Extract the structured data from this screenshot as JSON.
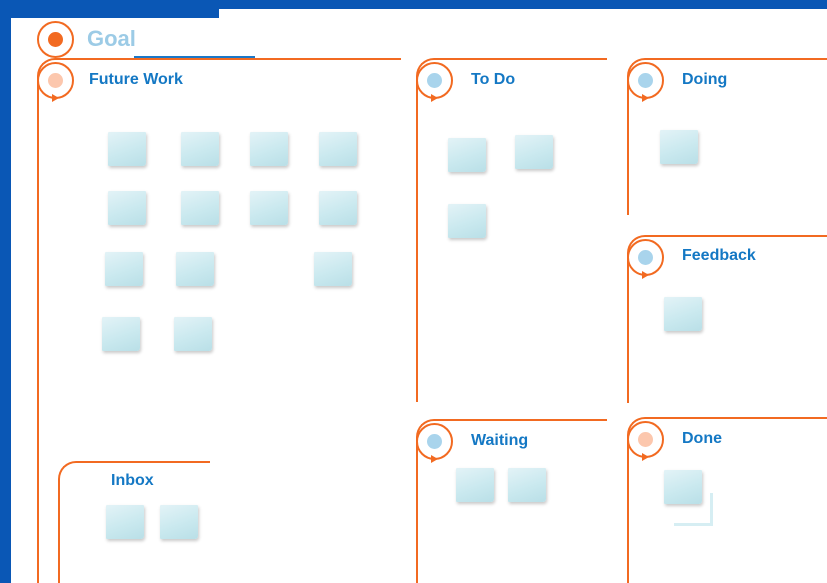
{
  "goal": {
    "label": "Goal"
  },
  "lanes": {
    "future_work": {
      "title": "Future Work"
    },
    "to_do": {
      "title": "To Do"
    },
    "doing": {
      "title": "Doing"
    },
    "feedback": {
      "title": "Feedback"
    },
    "waiting": {
      "title": "Waiting"
    },
    "done": {
      "title": "Done"
    },
    "inbox": {
      "title": "Inbox"
    }
  },
  "colors": {
    "background": "#0a57b5",
    "accent_orange": "#f26a21",
    "title_blue": "#1478c4",
    "goal_text": "#9ccbe6",
    "marker_orange": "#f26a21",
    "marker_peach": "#fcc7ad",
    "marker_blue": "#a9d4ec",
    "sticky_note": "#cae9ef"
  }
}
